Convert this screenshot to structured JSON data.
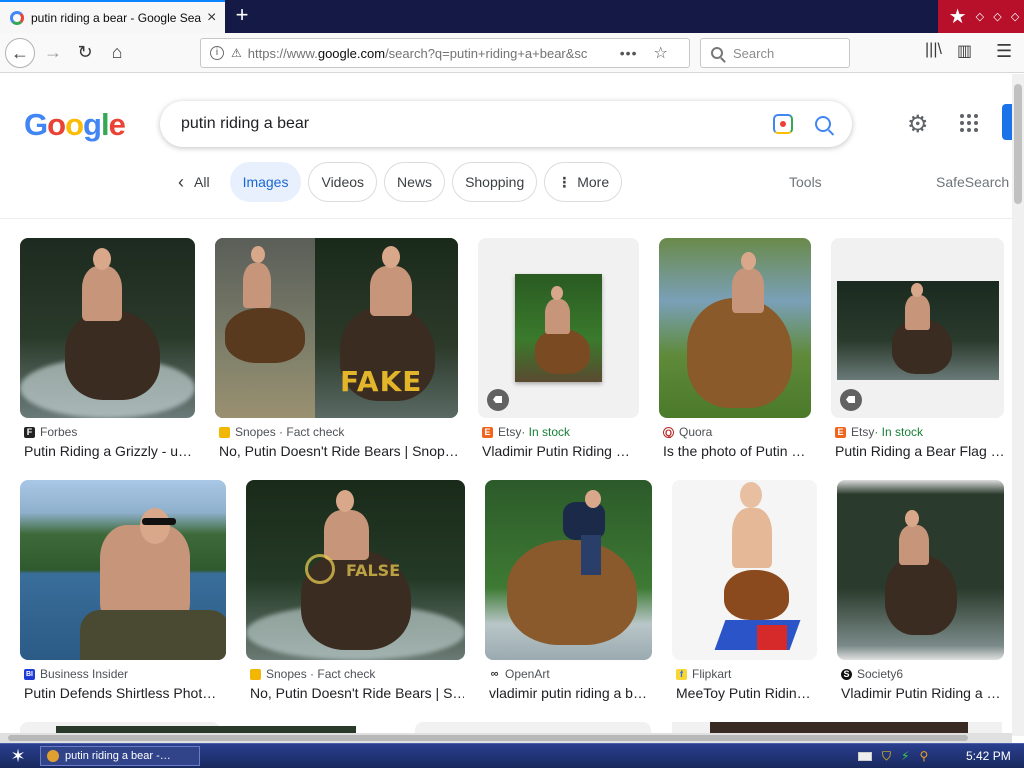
{
  "browser": {
    "tab_title": "putin riding a bear - Google Search",
    "url_prefix": "https://www.",
    "url_host": "google.com",
    "url_rest": "/search?q=putin+riding+a+bear&sc",
    "search_placeholder": "Search",
    "new_tab": "+",
    "close": "×",
    "page_actions": "•••",
    "bookmark_star": "☆"
  },
  "google": {
    "logo": [
      "G",
      "o",
      "o",
      "g",
      "l",
      "e"
    ],
    "query": "putin riding a bear",
    "chips": {
      "all": "All",
      "images": "Images",
      "videos": "Videos",
      "news": "News",
      "shopping": "Shopping",
      "more": "More"
    },
    "tools": "Tools",
    "safesearch": "SafeSearch"
  },
  "results": [
    {
      "source": "Forbes",
      "caption": "Putin Riding a Grizzly - u…",
      "icon_letter": "F",
      "icon_color": "#222222"
    },
    {
      "source": "Snopes · Fact check",
      "caption": "No, Putin Doesn't Ride Bears | Snop…",
      "icon_letter": "",
      "icon_color": "#f2b705",
      "overlay": "FAKE"
    },
    {
      "source": "Etsy",
      "stock": " · In stock",
      "caption": "Vladimir Putin Riding …",
      "icon_letter": "E",
      "icon_color": "#f1641e"
    },
    {
      "source": "Quora",
      "caption": "Is the photo of Putin …",
      "icon_letter": "Q",
      "icon_color": "#b92b27"
    },
    {
      "source": "Etsy",
      "stock": " · In stock",
      "caption": "Putin Riding a Bear Flag …",
      "icon_letter": "E",
      "icon_color": "#f1641e"
    },
    {
      "source": "Business Insider",
      "caption": "Putin Defends Shirtless Phot…",
      "icon_letter": "BI",
      "icon_color": "#1e3bd6"
    },
    {
      "source": "Snopes · Fact check",
      "caption": "No, Putin Doesn't Ride Bears | S…",
      "icon_letter": "",
      "icon_color": "#f2b705",
      "overlay": "FALSE"
    },
    {
      "source": "OpenArt",
      "caption": "vladimir putin riding a b…",
      "icon_letter": "∞",
      "icon_color": "#ffffff"
    },
    {
      "source": "Flipkart",
      "caption": "MeeToy Putin Ridin…",
      "icon_letter": "f",
      "icon_color": "#2874f0"
    },
    {
      "source": "Society6",
      "caption": "Vladimir Putin Riding a …",
      "icon_letter": "S",
      "icon_color": "#111111"
    }
  ],
  "taskbar": {
    "task_label": "putin riding a bear -…",
    "clock": "5:42 PM"
  }
}
